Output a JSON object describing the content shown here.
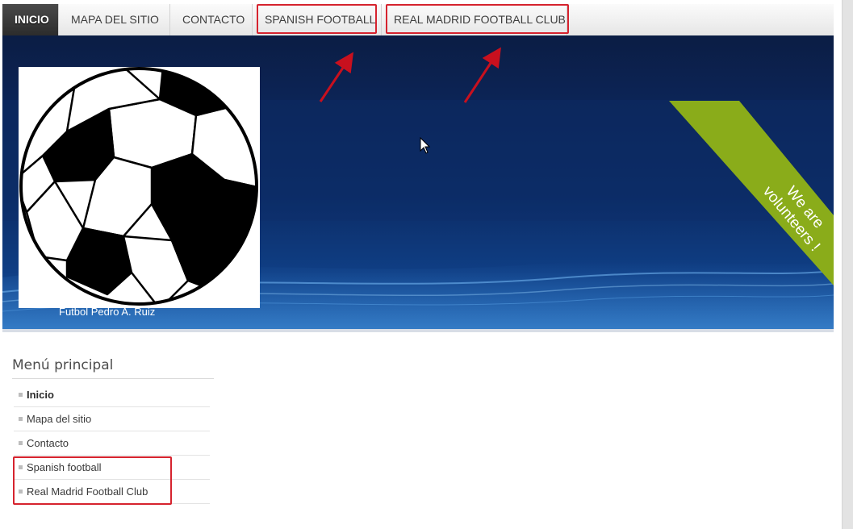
{
  "nav": {
    "items": [
      {
        "label": "Inicio",
        "active": true
      },
      {
        "label": "Mapa del sitio",
        "active": false
      },
      {
        "label": "Contacto",
        "active": false
      },
      {
        "label": "Spanish football",
        "active": false
      },
      {
        "label": "Real Madrid Football Club",
        "active": false
      }
    ]
  },
  "banner": {
    "site_title": "Futbol Pedro A. Ruiz",
    "ribbon_line1": "We are",
    "ribbon_line2": "volunteers !"
  },
  "sidebar": {
    "title": "Menú principal",
    "items": [
      {
        "label": "Inicio",
        "current": true
      },
      {
        "label": "Mapa del sitio",
        "current": false
      },
      {
        "label": "Contacto",
        "current": false
      },
      {
        "label": "Spanish football",
        "current": false
      },
      {
        "label": "Real Madrid Football Club",
        "current": false
      }
    ]
  },
  "colors": {
    "highlight": "#d6232e",
    "ribbon": "#8aac1a",
    "banner": "#0c2c66"
  }
}
